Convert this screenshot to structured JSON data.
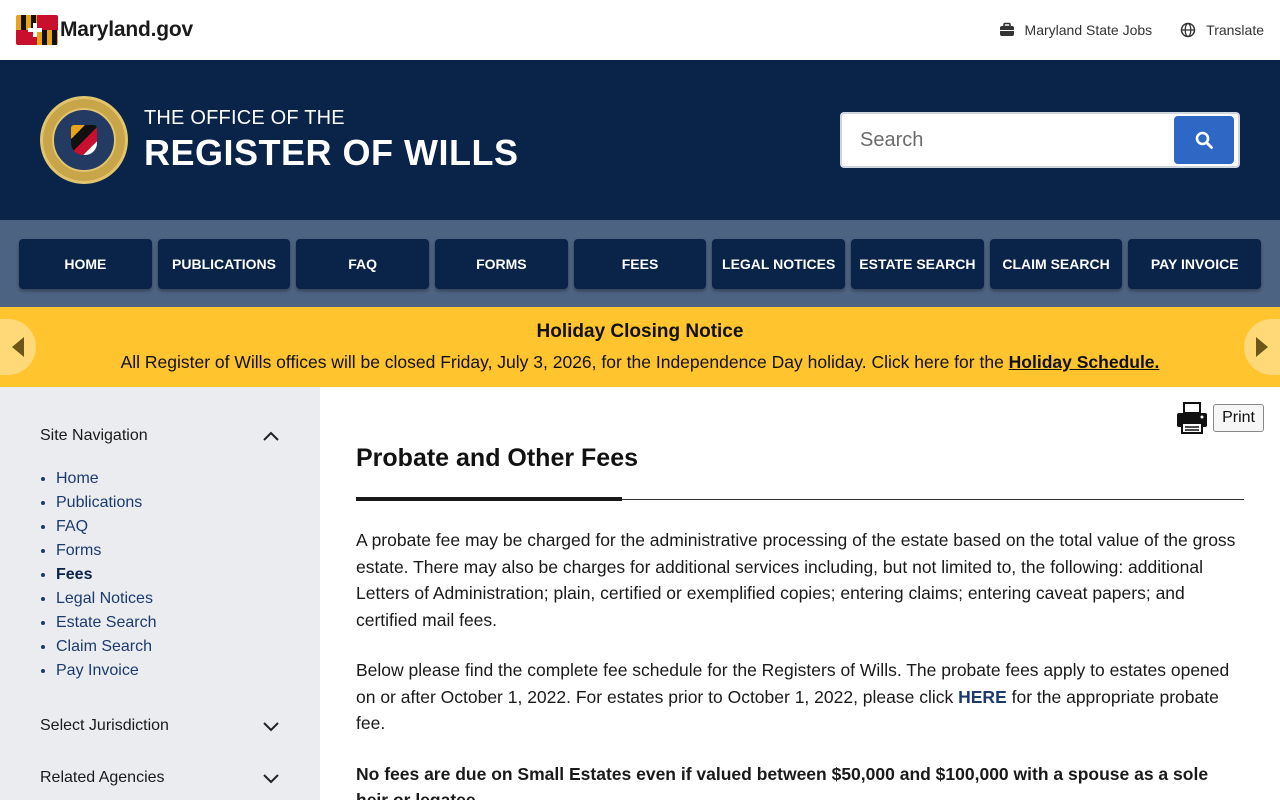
{
  "utility": {
    "logo_text": "Maryland.gov",
    "jobs_label": "Maryland State Jobs",
    "translate_label": "Translate"
  },
  "header": {
    "title_small": "THE OFFICE OF THE",
    "title_large": "REGISTER OF WILLS",
    "search_placeholder": "Search"
  },
  "nav": [
    "HOME",
    "PUBLICATIONS",
    "FAQ",
    "FORMS",
    "FEES",
    "LEGAL NOTICES",
    "ESTATE SEARCH",
    "CLAIM SEARCH",
    "PAY INVOICE"
  ],
  "alert": {
    "title": "Holiday Closing Notice",
    "message": "All Register of Wills offices will be closed Friday, July 3, 2026, for the Independence Day holiday. Click here for the ",
    "link": "Holiday Schedule."
  },
  "sidebar": {
    "heading": "Site Navigation",
    "items": [
      "Home",
      "Publications",
      "FAQ",
      "Forms",
      "Fees",
      "Legal Notices",
      "Estate Search",
      "Claim Search",
      "Pay Invoice"
    ],
    "active": "Fees",
    "jurisdiction": "Select Jurisdiction",
    "related": "Related Agencies"
  },
  "main": {
    "print_label": "Print",
    "title": "Probate and Other Fees",
    "para1": "A probate fee may be charged for the administrative processing of the estate based on the total value of the gross estate. There may also be charges for additional services including, but not limited to, the following: additional Letters of Administration; plain, certified or exemplified copies; entering claims; entering caveat papers; and certified mail fees.",
    "para2_before": "Below please find the complete fee schedule for the Registers of Wills. The probate fees apply to estates opened on or after October 1, 2022. For estates prior to October 1, 2022, please click ",
    "para2_link": "HERE",
    "para2_after": " for the appropriate probate fee.",
    "para3": "No fees are due on Small Estates even if valued between $50,000 and $100,000 with a spouse as a sole heir or legatee."
  }
}
